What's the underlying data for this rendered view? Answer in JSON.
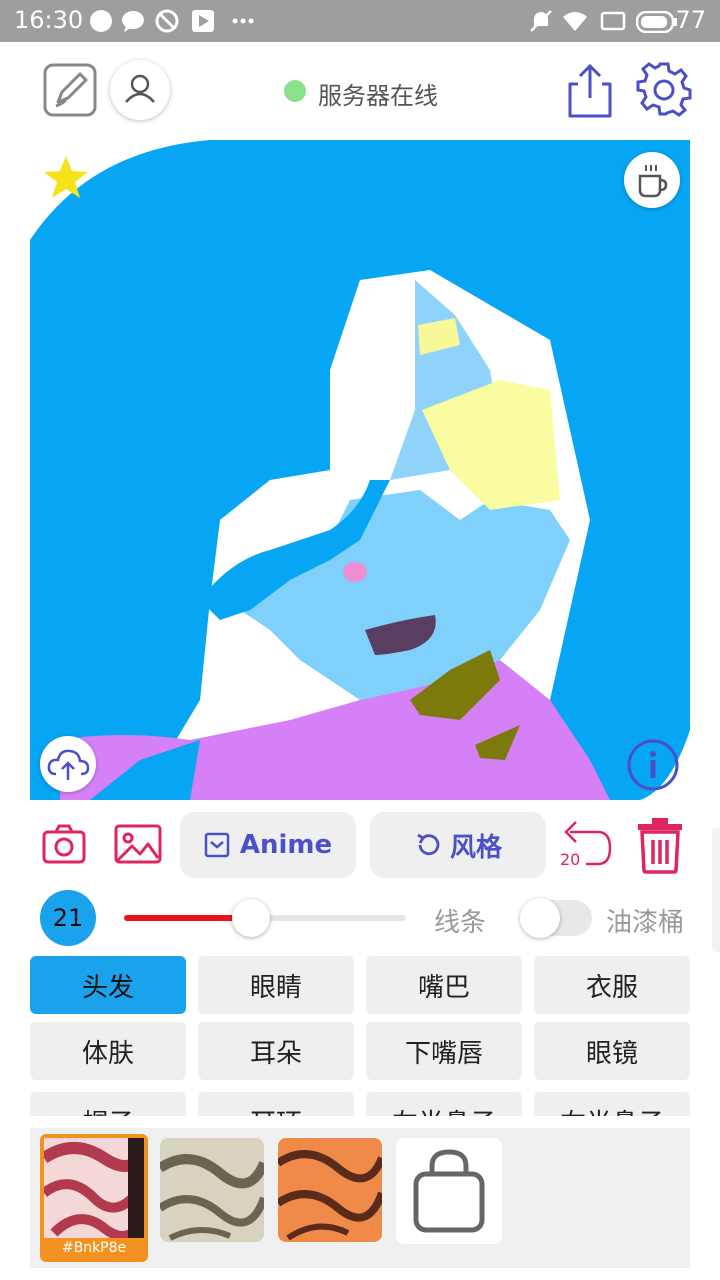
{
  "status_bar": {
    "time": "16:30",
    "battery": "77",
    "icons": [
      "chat-bubble-icon",
      "chat-bubble-icon",
      "blocked-icon",
      "play-store-icon",
      "more-dots-icon",
      "mute-icon",
      "wifi-icon",
      "screen-icon",
      "battery-icon"
    ]
  },
  "top_bar": {
    "server_status": "服务器在线",
    "server_status_color": "#8be08b",
    "accent": "#4b4fc8"
  },
  "tools": {
    "anime_label": "Anime",
    "style_label": "风格",
    "undo_count": "20",
    "brush_size": "21",
    "brush_size_fraction": 0.45,
    "line_label": "线条",
    "bucket_label": "油漆桶",
    "bucket_enabled": false,
    "danger_color": "#e0245e"
  },
  "parts": {
    "items": [
      {
        "label": "头发",
        "active": true
      },
      {
        "label": "眼睛",
        "active": false
      },
      {
        "label": "嘴巴",
        "active": false
      },
      {
        "label": "衣服",
        "active": false
      },
      {
        "label": "体肤",
        "active": false
      },
      {
        "label": "耳朵",
        "active": false
      },
      {
        "label": "下嘴唇",
        "active": false
      },
      {
        "label": "眼镜",
        "active": false
      },
      {
        "label": "帽子",
        "active": false
      },
      {
        "label": "耳环",
        "active": false
      },
      {
        "label": "左半鼻子",
        "active": false
      },
      {
        "label": "右半鼻子",
        "active": false
      }
    ]
  },
  "palette": {
    "selected_label": "#BnkP8e",
    "selected_color": "#f39221"
  }
}
